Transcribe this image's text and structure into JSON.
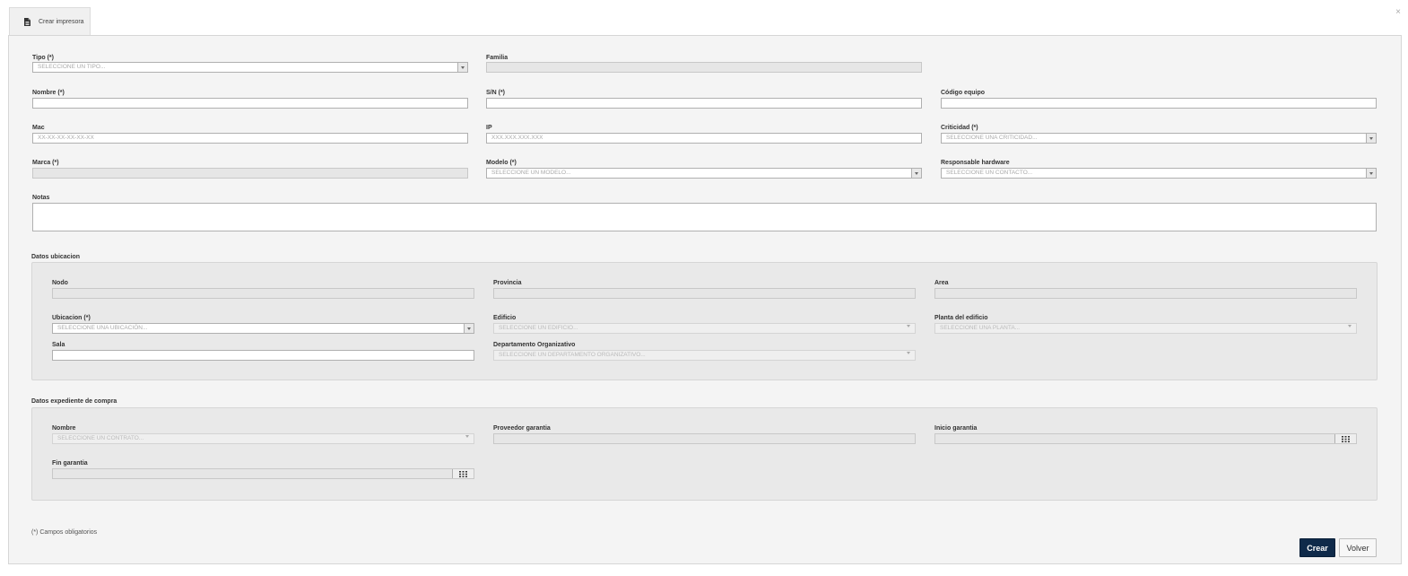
{
  "tab": {
    "title": "Crear impresora",
    "icon": "document-icon"
  },
  "close_label": "×",
  "form": {
    "tipo": {
      "label": "Tipo (*)",
      "placeholder": "SELECCIONE UN TIPO..."
    },
    "familia": {
      "label": "Familia"
    },
    "nombre": {
      "label": "Nombre (*)"
    },
    "sn": {
      "label": "S/N (*)"
    },
    "codigo_equipo": {
      "label": "Código equipo"
    },
    "mac": {
      "label": "Mac",
      "placeholder": "XX-XX-XX-XX-XX-XX"
    },
    "ip": {
      "label": "IP",
      "placeholder": "XXX.XXX.XXX.XXX"
    },
    "criticidad": {
      "label": "Criticidad (*)",
      "placeholder": "SELECCIONE UNA CRITICIDAD..."
    },
    "marca": {
      "label": "Marca (*)"
    },
    "modelo": {
      "label": "Modelo (*)",
      "placeholder": "SELECCIONE UN MODELO..."
    },
    "responsable": {
      "label": "Responsable hardware",
      "placeholder": "SELECCIONE UN CONTACTO..."
    },
    "notas": {
      "label": "Notas"
    }
  },
  "ubicacion": {
    "title": "Datos ubicacion",
    "nodo": {
      "label": "Nodo"
    },
    "provincia": {
      "label": "Provincia"
    },
    "area": {
      "label": "Area"
    },
    "ubicacion": {
      "label": "Ubicacion (*)",
      "placeholder": "SELECCIONE UNA UBICACIÓN..."
    },
    "edificio": {
      "label": "Edificio",
      "placeholder": "SELECCIONE UN EDIFICIO..."
    },
    "planta": {
      "label": "Planta del edificio",
      "placeholder": "SELECCIONE UNA PLANTA..."
    },
    "sala": {
      "label": "Sala"
    },
    "departamento": {
      "label": "Departamento Organizativo",
      "placeholder": "SELECCIONE UN DEPARTAMENTO ORGANIZATIVO..."
    }
  },
  "compra": {
    "title": "Datos expediente de compra",
    "nombre": {
      "label": "Nombre",
      "placeholder": "SELECCIONE UN CONTRATO..."
    },
    "proveedor": {
      "label": "Proveedor garantia"
    },
    "inicio": {
      "label": "Inicio garantia"
    },
    "fin": {
      "label": "Fin garantia"
    }
  },
  "footer": {
    "required_note": "(*) Campos obligatorios",
    "create_label": "Crear",
    "back_label": "Volver"
  }
}
